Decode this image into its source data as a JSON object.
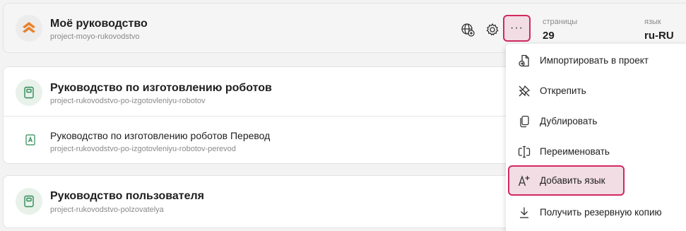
{
  "project": {
    "title": "Моё руководство",
    "slug": "project-moyo-rukovodstvo",
    "stats": {
      "pages_label": "страницы",
      "pages_value": "29",
      "lang_label": "язык",
      "lang_value": "ru-RU"
    },
    "more_label": "···"
  },
  "guides": [
    {
      "title": "Руководство по изготовлению роботов",
      "slug": "project-rukovodstvo-po-izgotovleniyu-robotov",
      "children": [
        {
          "title": "Руководство по изготовлению роботов Перевод",
          "slug": "project-rukovodstvo-po-izgotovleniyu-robotov-perevod"
        }
      ]
    },
    {
      "title": "Руководство пользователя",
      "slug": "project-rukovodstvo-polzovatelya",
      "children": []
    }
  ],
  "menu": {
    "items": [
      {
        "label": "Импортировать в проект",
        "icon": "import-icon"
      },
      {
        "label": "Открепить",
        "icon": "unpin-icon"
      },
      {
        "label": "Дублировать",
        "icon": "duplicate-icon"
      },
      {
        "label": "Переименовать",
        "icon": "rename-icon"
      },
      {
        "label": "Добавить язык",
        "icon": "add-language-icon",
        "highlighted": true
      },
      {
        "label": "Получить резервную копию",
        "icon": "download-icon"
      }
    ]
  },
  "colors": {
    "accent": "#d2295f",
    "accent_bg": "#f2dde5",
    "logo_orange": "#e8822a",
    "guide_green": "#2e8b57"
  }
}
